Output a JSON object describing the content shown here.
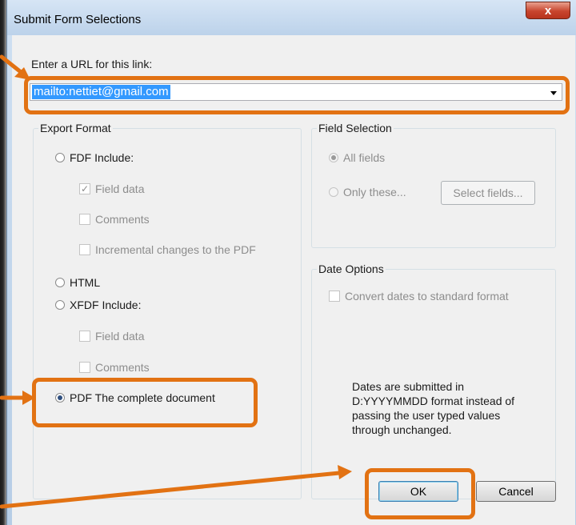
{
  "window": {
    "title": "Submit Form Selections",
    "close_glyph": "x"
  },
  "url": {
    "label": "Enter a URL for this link:",
    "value": "mailto:nettiet@gmail.com"
  },
  "export_format": {
    "legend": "Export Format",
    "fdf": {
      "label": "FDF  Include:",
      "selected": false,
      "field_data": "Field data",
      "comments": "Comments",
      "incremental": "Incremental changes to the PDF"
    },
    "html": {
      "label": "HTML",
      "selected": false
    },
    "xfdf": {
      "label": "XFDF  Include:",
      "selected": false,
      "field_data": "Field data",
      "comments": "Comments"
    },
    "pdf": {
      "label": "PDF  The complete document",
      "selected": true
    }
  },
  "field_selection": {
    "legend": "Field Selection",
    "all_fields": "All fields",
    "only_these": "Only these...",
    "select_fields_button": "Select fields..."
  },
  "date_options": {
    "legend": "Date Options",
    "convert": "Convert dates to standard format",
    "note": "Dates are submitted in D:YYYYMMDD format instead of passing the user typed values through unchanged."
  },
  "buttons": {
    "ok": "OK",
    "cancel": "Cancel"
  },
  "check_glyph": "✓",
  "colors": {
    "highlight": "#e27213",
    "selection": "#3399ff"
  }
}
